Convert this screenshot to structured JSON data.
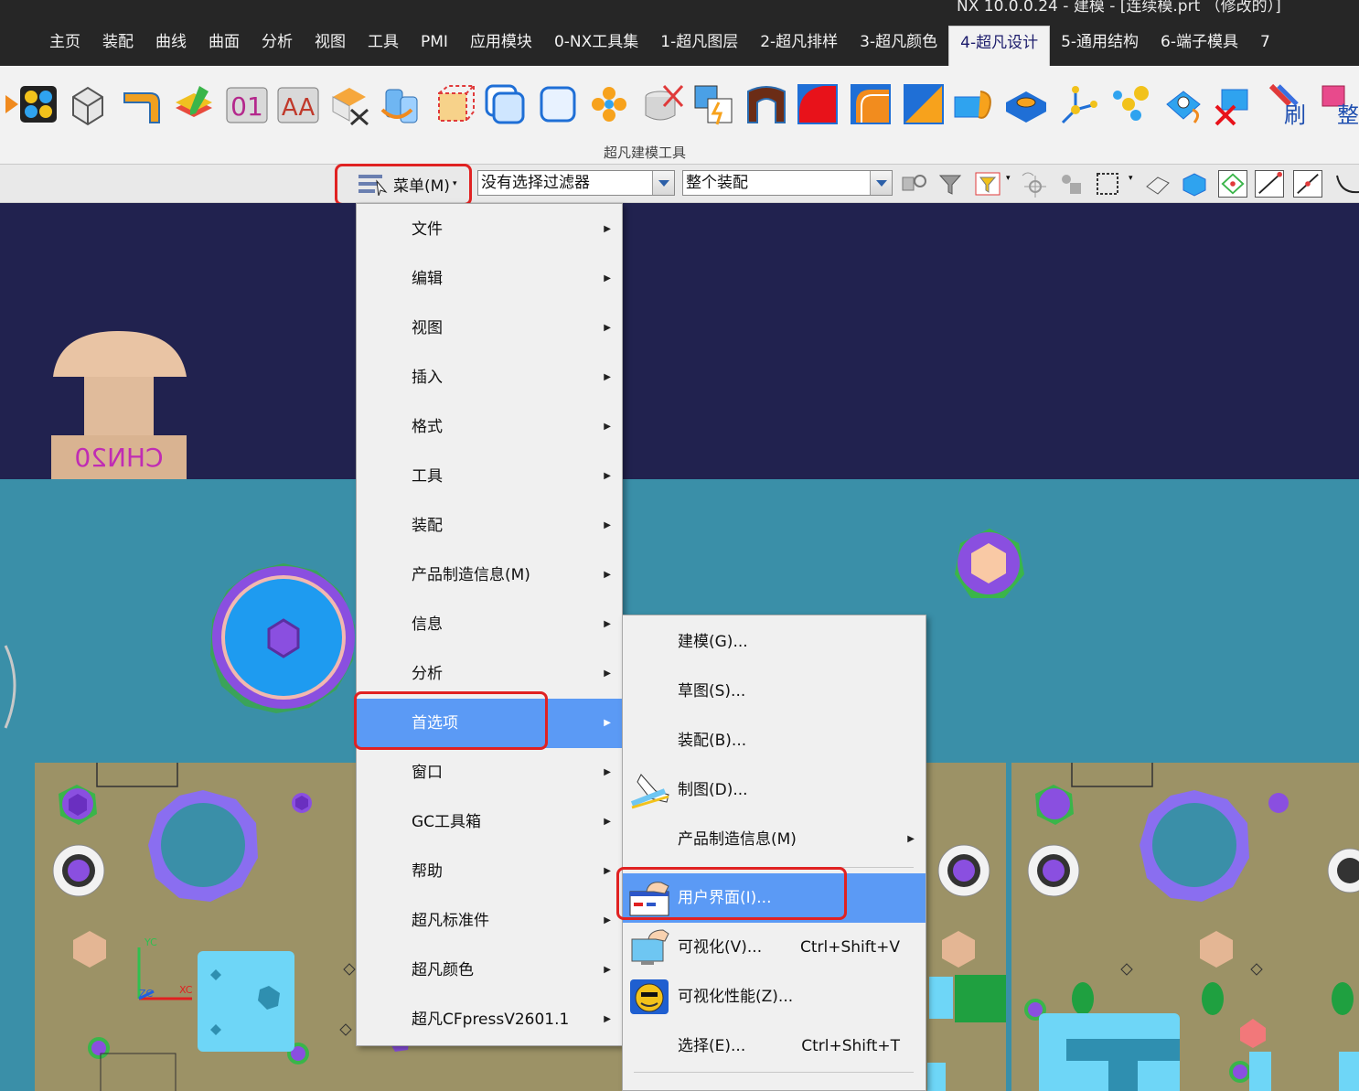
{
  "window": {
    "title": "NX 10.0.0.24 - 建模 - [连续模.prt （修改的）]"
  },
  "tabs": [
    {
      "label": "主页"
    },
    {
      "label": "装配"
    },
    {
      "label": "曲线"
    },
    {
      "label": "曲面"
    },
    {
      "label": "分析"
    },
    {
      "label": "视图"
    },
    {
      "label": "工具"
    },
    {
      "label": "PMI"
    },
    {
      "label": "应用模块"
    },
    {
      "label": "0-NX工具集"
    },
    {
      "label": "1-超凡图层"
    },
    {
      "label": "2-超凡排样"
    },
    {
      "label": "3-超凡颜色"
    },
    {
      "label": "4-超凡设计",
      "active": true
    },
    {
      "label": "5-通用结构"
    },
    {
      "label": "6-端子模具"
    },
    {
      "label": "7"
    }
  ],
  "ribbon": {
    "group_label": "超凡建模工具",
    "icon_text": {
      "text_01": "01",
      "text_aa": "AA",
      "brush": "刷",
      "tidy": "整"
    }
  },
  "toolbar": {
    "menu_label": "菜单(M)",
    "filter_value": "没有选择过滤器",
    "scope_value": "整个装配"
  },
  "viewport": {
    "part_label": "CHN20",
    "axis_labels": {
      "yc": "YC",
      "xc": "XC",
      "zc": "ZC"
    }
  },
  "main_menu": {
    "items": [
      {
        "label": "文件",
        "submenu": true
      },
      {
        "label": "编辑",
        "submenu": true
      },
      {
        "label": "视图",
        "submenu": true
      },
      {
        "label": "插入",
        "submenu": true
      },
      {
        "label": "格式",
        "submenu": true
      },
      {
        "label": "工具",
        "submenu": true
      },
      {
        "label": "装配",
        "submenu": true
      },
      {
        "label": "产品制造信息(M)",
        "submenu": true
      },
      {
        "label": "信息",
        "submenu": true
      },
      {
        "label": "分析",
        "submenu": true
      },
      {
        "label": "首选项",
        "submenu": true,
        "selected": true
      },
      {
        "label": "窗口",
        "submenu": true
      },
      {
        "label": "GC工具箱",
        "submenu": true
      },
      {
        "label": "帮助",
        "submenu": true
      },
      {
        "label": "超凡标准件",
        "submenu": true
      },
      {
        "label": "超凡颜色",
        "submenu": true
      },
      {
        "label": "超凡CFpressV2601.1",
        "submenu": true
      }
    ]
  },
  "preferences_menu": {
    "items": [
      {
        "label": "建模(G)...",
        "icon": ""
      },
      {
        "label": "草图(S)...",
        "icon": ""
      },
      {
        "label": "装配(B)...",
        "icon": ""
      },
      {
        "label": "制图(D)...",
        "icon": "drafting-icon"
      },
      {
        "label": "产品制造信息(M)",
        "submenu": true
      },
      {
        "label": "用户界面(I)...",
        "icon": "user-interface-icon",
        "selected": true
      },
      {
        "label": "可视化(V)...",
        "shortcut": "Ctrl+Shift+V",
        "icon": "visualization-icon"
      },
      {
        "label": "可视化性能(Z)...",
        "icon": "visualization-performance-icon"
      },
      {
        "label": "选择(E)...",
        "shortcut": "Ctrl+Shift+T"
      }
    ]
  },
  "colors": {
    "titlebar": "#262626",
    "ribbon": "#f2f2f2",
    "viewport_bg": "#21224f",
    "plate": "#3a8fa8",
    "die_plate": "#9c9266",
    "selection": "#5b9af5",
    "highlight_box": "#e02222"
  }
}
